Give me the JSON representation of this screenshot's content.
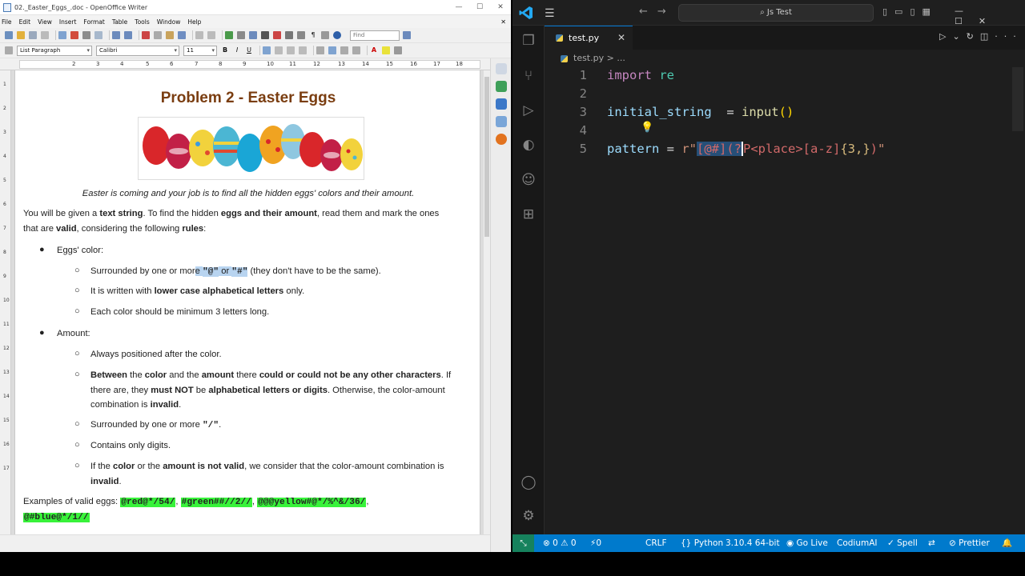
{
  "writer": {
    "window_title": "02._Easter_Eggs_.doc - OpenOffice Writer",
    "menu": [
      "File",
      "Edit",
      "View",
      "Insert",
      "Format",
      "Table",
      "Tools",
      "Window",
      "Help"
    ],
    "find_placeholder": "Find",
    "paragraph_style": "List Paragraph",
    "font_name": "Calibri",
    "font_size": "11",
    "ruler_numbers": [
      "1",
      "2",
      "3",
      "4",
      "5",
      "6",
      "7",
      "8",
      "9",
      "10",
      "11",
      "12",
      "13",
      "14",
      "15",
      "16",
      "17",
      "18"
    ],
    "vruler_numbers": [
      "1",
      "2",
      "3",
      "4",
      "5",
      "6",
      "7",
      "8",
      "9",
      "10",
      "11",
      "12",
      "13",
      "14",
      "15",
      "16",
      "17"
    ],
    "doc": {
      "title": "Problem 2 - Easter Eggs",
      "caption": "Easter is coming and your job is to find all the hidden eggs' colors and their amount.",
      "intro": {
        "t1": "You will be given a ",
        "b1": "text string",
        "t2": ". To find the hidden ",
        "b2": "eggs and their amount",
        "t3": ", read them and mark the ones",
        "t4": "that are ",
        "b3": "valid",
        "t5": ", considering the following ",
        "b4": "rules",
        "t6": ":"
      },
      "color_heading": "Eggs' color:",
      "color_rule1": {
        "t1": "Surrounded by one or mor",
        "sel1": "e ",
        "m1": "\"@\"",
        "sel2": " or ",
        "m2": "\"#\"",
        "t2": " (they don't have to be the same)."
      },
      "color_rule2": {
        "t1": "It is written with ",
        "b1": "lower case alphabetical letters",
        "t2": " only."
      },
      "color_rule3": "Each color should be minimum 3 letters long.",
      "amount_heading": "Amount:",
      "amount_rule1": "Always positioned after the color.",
      "amount_rule2": {
        "b1": "Between",
        "t1": " the ",
        "b2": "color",
        "t2": " and the ",
        "b3": "amount",
        "t3": " there ",
        "b4": "could or could not be any other characters",
        "t4": ". If",
        "t5": "there are, they ",
        "b5": "must NOT",
        "t6": " be ",
        "b6": "alphabetical letters or digits",
        "t7": ". Otherwise, the color-amount",
        "t8": "combination is ",
        "b7": "invalid",
        "t9": "."
      },
      "amount_rule3": {
        "t1": "Surrounded by one or more ",
        "m1": "\"/\"",
        "t2": "."
      },
      "amount_rule4": "Contains only digits.",
      "amount_rule5": {
        "t1": "If the ",
        "b1": "color",
        "t2": " or the ",
        "b2": "amount is not valid",
        "t3": ", we consider that the color-amount combination is",
        "b3": "invalid",
        "t4": "."
      },
      "examples_label": "Examples of valid eggs: ",
      "examples": [
        "@red@*/54/",
        "#green##//2//",
        "@@@yellow#@*/%^&/36/",
        "@#blue@*/1//"
      ]
    }
  },
  "vscode": {
    "search": "Js Test",
    "tab_label": "test.py",
    "breadcrumb_file": "test.py",
    "breadcrumb_more": "...",
    "line_numbers": [
      "1",
      "2",
      "3",
      "4",
      "5"
    ],
    "code": {
      "l1_kw": "import",
      "l1_mod": "re",
      "l3_var": "initial_string",
      "l3_eq": "  = ",
      "l3_fn": "input",
      "l3_paren": "()",
      "l5_var": "pattern",
      "l5_eq": " = ",
      "l5_prefix": "r\"",
      "l5_sel1": "[@#](?",
      "l5_sel2": "P",
      "l5_group": "<place>",
      "l5_class": "[a-z]",
      "l5_quant": "{3,}",
      "l5_close": ")",
      "l5_quote": "\""
    },
    "status": {
      "problems": "⊗ 0 ⚠ 0",
      "ports": "⚡0",
      "eol": "CRLF",
      "language": "Python",
      "interpreter": "3.10.4 64-bit",
      "golive": "Go Live",
      "ai": "CodiumAI",
      "spell": "✓ Spell",
      "prettier": "Prettier"
    }
  }
}
